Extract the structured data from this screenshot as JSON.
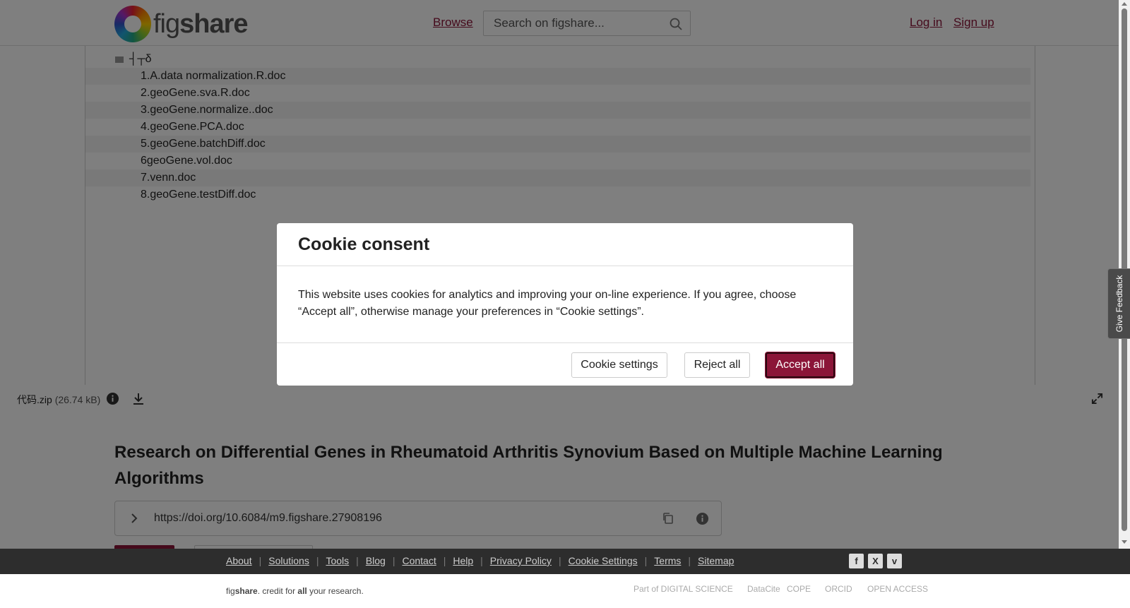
{
  "header": {
    "logo_prefix": "fig",
    "logo_suffix": "share",
    "browse": "Browse",
    "search_placeholder": "Search on figshare...",
    "login": "Log in",
    "signup": "Sign up"
  },
  "viewer": {
    "root_folder": "┤┬δ",
    "files": [
      "1.A.data normalization.R.doc",
      "2.geoGene.sva.R.doc",
      "3.geoGene.normalize..doc",
      "4.geoGene.PCA.doc",
      "5.geoGene.batchDiff.doc",
      "6geoGene.vol.doc",
      "7.venn.doc",
      "8.geoGene.testDiff.doc"
    ]
  },
  "file_bar": {
    "name": "代码.zip",
    "size": "(26.74 kB)"
  },
  "article": {
    "title": "Research on Differential Genes in Rheumatoid Arthritis Synovium Based on Multiple Machine Learning Algorithms",
    "doi": "https://doi.org/10.6084/m9.figshare.27908196"
  },
  "feedback": "Give Feedback",
  "modal": {
    "title": "Cookie consent",
    "body": "This website uses cookies for analytics and improving your on-line experience. If you agree, choose “Accept all”, otherwise manage your preferences in “Cookie settings”.",
    "settings": "Cookie settings",
    "reject": "Reject all",
    "accept": "Accept all"
  },
  "footer": {
    "links": [
      "About",
      "Solutions",
      "Tools",
      "Blog",
      "Contact",
      "Help",
      "Privacy Policy",
      "Cookie Settings",
      "Terms",
      "Sitemap"
    ],
    "tagline_fig": "fig",
    "tagline_share": "share",
    "tagline_mid": ". credit for ",
    "tagline_all": "all",
    "tagline_end": " your research.",
    "partners": [
      "Part of DIGITAL SCIENCE",
      "DataCite",
      "COPE",
      "ORCID",
      "OPEN ACCESS"
    ]
  },
  "colors": {
    "brand": "#8b1538",
    "footer_bg": "#2d2d2d"
  }
}
